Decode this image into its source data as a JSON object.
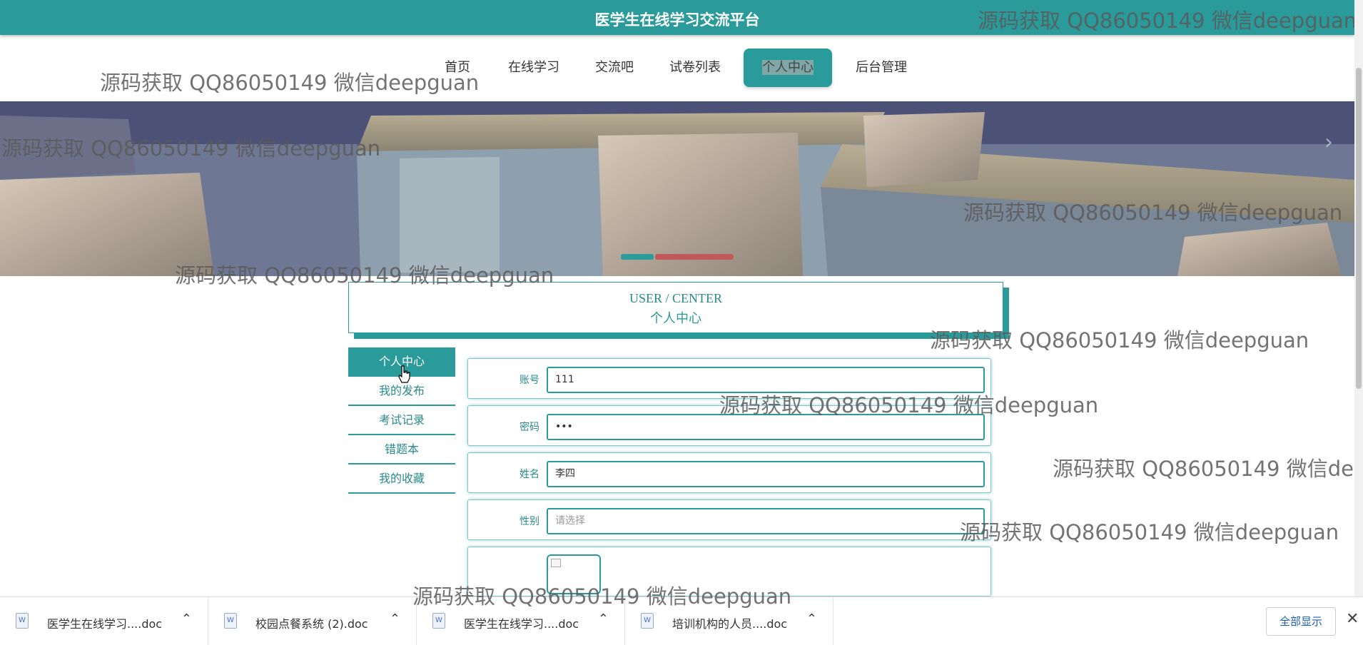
{
  "header": {
    "site_title": "医学生在线学习交流平台"
  },
  "nav": {
    "items": [
      {
        "label": "首页"
      },
      {
        "label": "在线学习"
      },
      {
        "label": "交流吧"
      },
      {
        "label": "试卷列表"
      },
      {
        "label": "个人中心",
        "active": true
      },
      {
        "label": "后台管理"
      }
    ]
  },
  "banner": {
    "next_icon": "chevron-right-icon"
  },
  "page_heading": {
    "en": "USER / CENTER",
    "zh": "个人中心"
  },
  "side_menu": {
    "items": [
      {
        "label": "个人中心",
        "active": true
      },
      {
        "label": "我的发布"
      },
      {
        "label": "考试记录"
      },
      {
        "label": "错题本"
      },
      {
        "label": "我的收藏"
      }
    ]
  },
  "form": {
    "account_label": "账号",
    "account_value": "111",
    "password_label": "密码",
    "password_value": "•••",
    "name_label": "姓名",
    "name_value": "李四",
    "gender_label": "性别",
    "gender_placeholder": "请选择"
  },
  "watermark": "源码获取 QQ86050149 微信deepguan",
  "downloads": {
    "items": [
      {
        "name": "医学生在线学习....doc"
      },
      {
        "name": "校园点餐系统 (2).doc"
      },
      {
        "name": "医学生在线学习....doc"
      },
      {
        "name": "培训机构的人员....doc"
      }
    ],
    "show_all": "全部显示"
  },
  "colors": {
    "accent": "#2a9a9a"
  }
}
